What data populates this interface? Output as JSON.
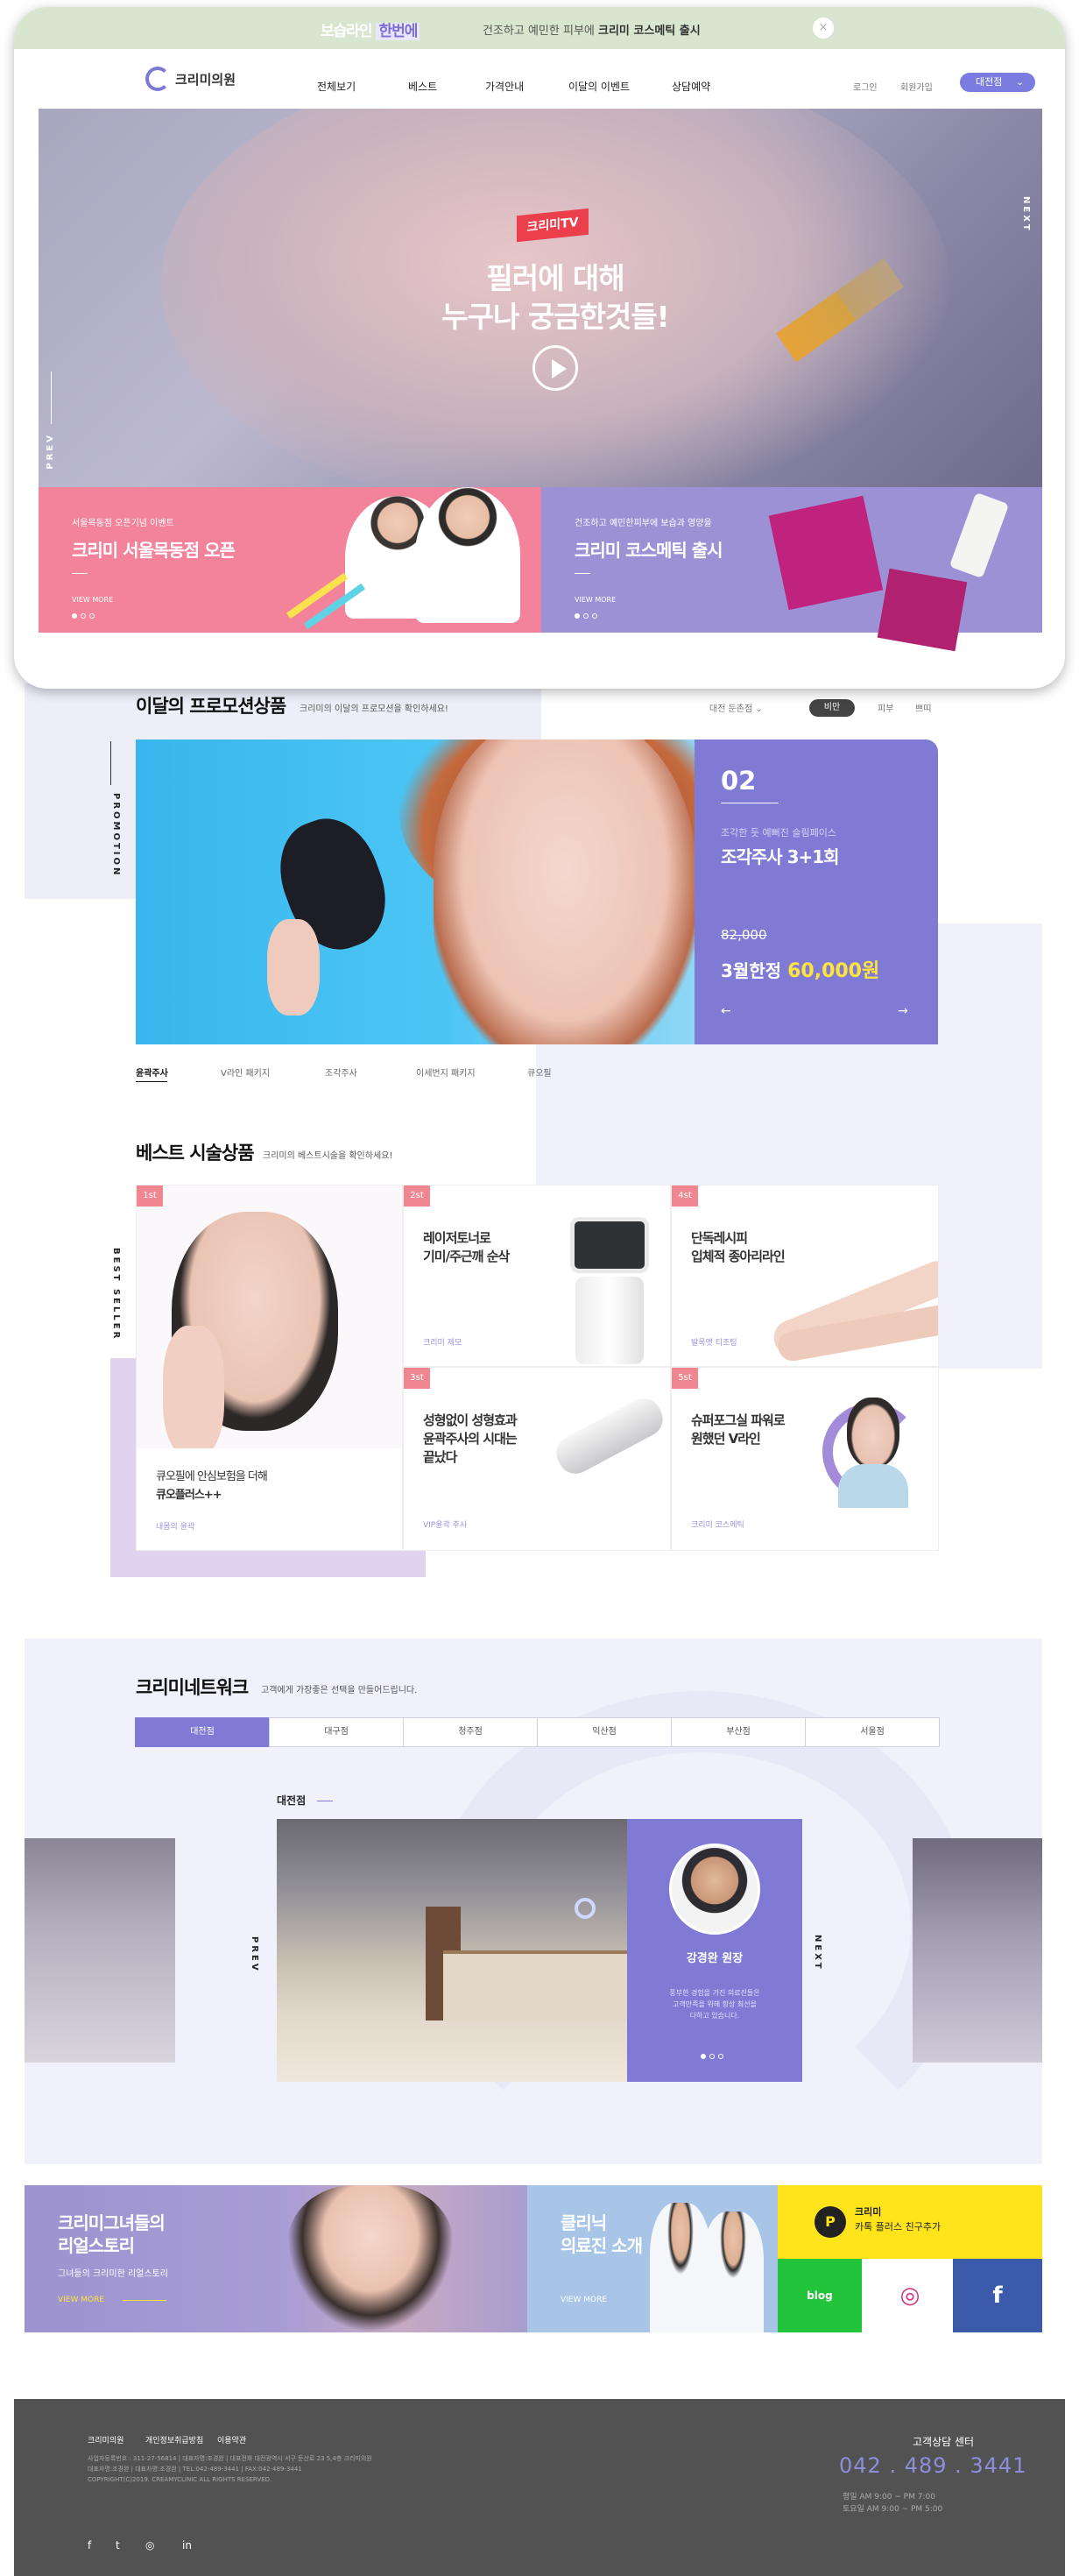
{
  "topbar": {
    "promo_prefix": "보습라인",
    "promo_hl": "한번에",
    "promo_text": "건조하고 예민한 피부에",
    "promo_bold": "크리미 코스메틱 출시",
    "close": "×"
  },
  "brand": {
    "name": "크리미의원",
    "accent": "#7f7bd4",
    "pink": "#f08790",
    "yellow": "#ffe43b"
  },
  "nav": {
    "items": [
      "전체보기",
      "베스트",
      "가격안내",
      "이달의 이벤트",
      "상담예약"
    ],
    "login": "로그인",
    "join": "회원가입",
    "branch": "대전점"
  },
  "hero": {
    "badge": "크리미TV",
    "title_l1": "필러에 대해",
    "title_l2": "누구나 궁금한것들!",
    "next": "NEXT",
    "prev": "PREV"
  },
  "banners": [
    {
      "sub": "서울목동점 오픈기념 이벤트",
      "title": "크리미 서울목동점 오픈",
      "more": "VIEW MORE"
    },
    {
      "sub": "건조하고 예민한피부에 보습과 영양을",
      "title": "크리미 코스메틱 출시",
      "more": "VIEW MORE"
    }
  ],
  "promotion": {
    "title": "이달의 프로모션상품",
    "sub": "크리미의 이달의 프로모션을 확인하세요!",
    "vlabel": "PROMOTION",
    "sort": "대전 둔촌점",
    "filters": [
      "비만",
      "피부",
      "쁘띠"
    ],
    "card": {
      "num": "02",
      "desc": "조각한 듯 예뻐진 슬림페이스",
      "title": "조각주사 3+1회",
      "old_price": "82,000",
      "price_prefix": "3월한정",
      "price": "60,000원"
    },
    "tabs": [
      "윤곽주사",
      "V라인 패키지",
      "조각주사",
      "이세번지 패키지",
      "큐오필"
    ]
  },
  "best": {
    "title": "베스트 시술상품",
    "sub": "크리미의 베스트시술을 확인하세요!",
    "vlabel": "BEST SELLER",
    "items": [
      {
        "rank": "1st",
        "title_l1": "큐오필에 안심보험을 더해",
        "title_l2": "큐오플러스++",
        "sub": "내몸의 윤곽"
      },
      {
        "rank": "2st",
        "title_l1": "레이저토너로",
        "title_l2": "기미/주근깨 순삭",
        "sub": "크리미 제모"
      },
      {
        "rank": "4st",
        "title_l1": "단독레시피",
        "title_l2": "입체적 종아리라인",
        "sub": "발목엣 티조팅"
      },
      {
        "rank": "3st",
        "title_l1": "성형없이 성형효과",
        "title_l2": "윤곽주사의 시대는",
        "title_l3": "끝났다",
        "sub": "VIP윤곽 주사"
      },
      {
        "rank": "5st",
        "title_l1": "슈퍼포그실 파워로",
        "title_l2": "원했던 V라인",
        "sub": "크리미 코스메틱"
      }
    ]
  },
  "network": {
    "title": "크리미네트워크",
    "sub": "고객에게 가장좋은 선택을 만들어드립니다.",
    "tabs": [
      "대전점",
      "대구점",
      "청주점",
      "익산점",
      "부산점",
      "서울점"
    ],
    "branch": "대전점",
    "prev": "PREV",
    "next": "NEXT",
    "doctor": {
      "name": "강경완 원장",
      "desc_l1": "풍부한 경험을 가진 의료진들은",
      "desc_l2": "고객만족을 위해 항상 최선을",
      "desc_l3": "다하고 있습니다."
    }
  },
  "bottom": [
    {
      "title_l1": "크리미그녀들의",
      "title_l2": "리얼스토리",
      "sub": "그녀들의 크리미한 리얼스토리",
      "more": "VIEW MORE"
    },
    {
      "title_l1": "클리닉",
      "title_l2": "의료진 소개",
      "more": "VIEW MORE"
    },
    {
      "title_l1": "크리미",
      "title_l2": "카톡 플러스 친구추가"
    }
  ],
  "sns": {
    "blog": "blog",
    "insta": "◎",
    "fb": "f"
  },
  "footer": {
    "links": [
      "크리미의원",
      "개인정보취급방침",
      "이용약관"
    ],
    "info_l1": "사업자등록번호 : 311-27-56814 | 대표자명:조경완 | 대표전화 대전광역시 서구 둔산로 23 5,4층 크리미의원",
    "info_l2": "대표자명:조경완 | 대표자명:조경완 | TEL:042-489-3441 | FAX:042-489-3441",
    "info_l3": "COPYRIGHT(C)2019. CREAMYCLINIC ALL RIGHTS RESERVED.",
    "center": "고객상담 센터",
    "tel": "042 . 489 . 3441",
    "hours_l1": "평일  AM 9:00 ~ PM 7:00",
    "hours_l2": "토요일  AM 9:00 ~ PM 5:00",
    "social": [
      "f",
      "t",
      "◎",
      "in"
    ]
  }
}
